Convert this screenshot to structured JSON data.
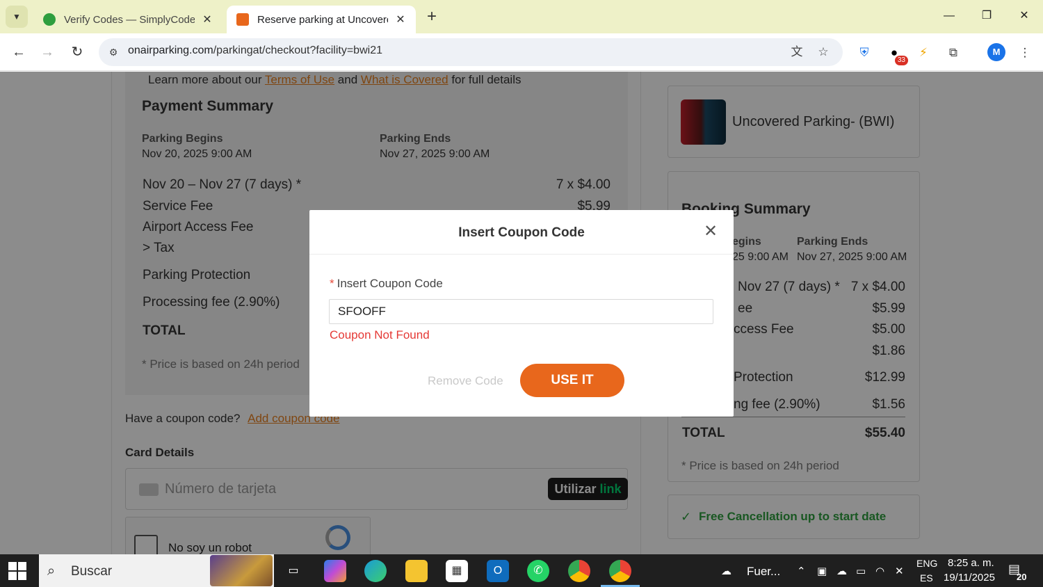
{
  "browser": {
    "tabs": [
      {
        "title": "Verify Codes — SimplyCodes",
        "active": false
      },
      {
        "title": "Reserve parking at Uncovered P",
        "active": true
      }
    ],
    "url_host": "onairparking.com",
    "url_path": "/parkingat/checkout?facility=bwi21",
    "profile_initial": "M",
    "extension_badge": "33"
  },
  "left": {
    "learn_prefix": "Learn more about our",
    "terms_link": "Terms of Use",
    "and": "and",
    "covered_link": "What is Covered",
    "learn_suffix": "for full details",
    "payment_summary_title": "Payment Summary",
    "begins_label": "Parking Begins",
    "begins_value": "Nov 20, 2025 9:00 AM",
    "ends_label": "Parking Ends",
    "ends_value": "Nov 27, 2025 9:00 AM",
    "lines": [
      {
        "label": "Nov 20 – Nov 27 (7 days) *",
        "value": "7 x $4.00"
      },
      {
        "label": "Service Fee",
        "value": "$5.99"
      },
      {
        "label": "Airport Access Fee",
        "value": ""
      },
      {
        "label": "> Tax",
        "value": ""
      },
      {
        "label": "Parking Protection",
        "value": ""
      },
      {
        "label": "Processing fee (2.90%)",
        "value": ""
      }
    ],
    "total_label": "TOTAL",
    "price_note": "* Price is based on 24h period",
    "coupon_question": "Have a coupon code?",
    "add_coupon_link": "Add coupon code",
    "card_details_title": "Card Details",
    "card_placeholder": "Número de tarjeta",
    "link_button_prefix": "Utilizar",
    "link_button_brand": "link",
    "captcha_label": "No soy un robot"
  },
  "right": {
    "facility_name": "Uncovered Parking- (BWI)",
    "booking_title": "Booking Summary",
    "begins_label": "egins",
    "begins_value": "25 9:00 AM",
    "ends_label": "Parking Ends",
    "ends_value": "Nov 27, 2025 9:00 AM",
    "lines": [
      {
        "label": "Nov 27 (7 days) *",
        "value": "7 x $4.00"
      },
      {
        "label": "ee",
        "value": "$5.99"
      },
      {
        "label": "ccess Fee",
        "value": "$5.00"
      },
      {
        "label": "",
        "value": "$1.86"
      },
      {
        "label": "Protection",
        "value": "$12.99"
      },
      {
        "label": "ng fee (2.90%)",
        "value": "$1.56"
      }
    ],
    "total_label": "TOTAL",
    "total_value": "$55.40",
    "price_note": "* Price is based on 24h period",
    "free_cancel": "Free Cancellation up to start date"
  },
  "modal": {
    "title": "Insert Coupon Code",
    "field_label": "Insert Coupon Code",
    "input_value": "SFOOFF",
    "error": "Coupon Not Found",
    "remove_label": "Remove Code",
    "use_label": "USE IT"
  },
  "taskbar": {
    "search_placeholder": "Buscar",
    "weather": "Fuer...",
    "lang_line1": "ENG",
    "lang_line2": "ES",
    "time": "8:25 a. m.",
    "date": "19/11/2025",
    "notifications": "20"
  },
  "colors": {
    "accent_orange": "#e8671c",
    "link_orange": "#e8801f",
    "error_red": "#e53935",
    "success_green": "#2e9e3e"
  }
}
